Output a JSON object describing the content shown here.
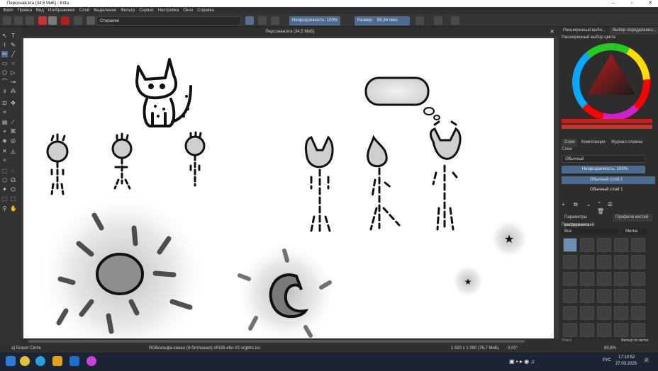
{
  "window": {
    "title": "Персонаж.kra (34,5 МиБ) - Krita"
  },
  "menu": [
    "Файл",
    "Правка",
    "Вид",
    "Изображение",
    "Слой",
    "Выделение",
    "Фильтр",
    "Сервис",
    "Настройка",
    "Окно",
    "Справка"
  ],
  "toolbar": {
    "blend_mode": "Стирание",
    "opacity_label": "Непрозрачность: 100%",
    "size_label": "Размер:",
    "size_value": "85,34 пикс"
  },
  "document": {
    "tab_title": "Персонаж.kra (34,5 МиБ)"
  },
  "right_panel": {
    "tab_advanced": "Расширенный выбо...",
    "tab_selector": "Выбор определенно...",
    "color_header": "Расширенный выбор цвета",
    "tab_layers": "Слои",
    "tab_compositions": "Композиции",
    "tab_history": "Журнал отмены",
    "layers_title": "Слои",
    "blend_mode": "Обычный",
    "layer_opacity": "Непрозрачность: 100%",
    "layers": [
      "Обычный слой 1",
      "Обычный слой 1"
    ],
    "tab_tool_options": "Параметры инструмента",
    "tab_brush_presets": "Профили кистей",
    "brush_header": "Профили кистей",
    "brush_filter": "Все",
    "brush_tag": "Метка",
    "search_placeholder": "Поиск",
    "filter_by_tag": "Фильтр по метке"
  },
  "status": {
    "brush": "a) Eraser Circle",
    "colorspace": "RGB/альфа-канал (8-бит/канал)  sRGB-elle-V2-srgbtrc.icc",
    "dimensions": "1 920 x 1 080 (76,7 МиБ)",
    "rotation": "0,00°",
    "zoom": "80,8%"
  },
  "taskbar": {
    "lang": "РУС",
    "time": "17:10:52",
    "date": "27.03.2025",
    "notifications": "2"
  },
  "icons": {
    "close": "close-icon",
    "minimize": "minimize-icon",
    "maximize": "maximize-icon"
  }
}
